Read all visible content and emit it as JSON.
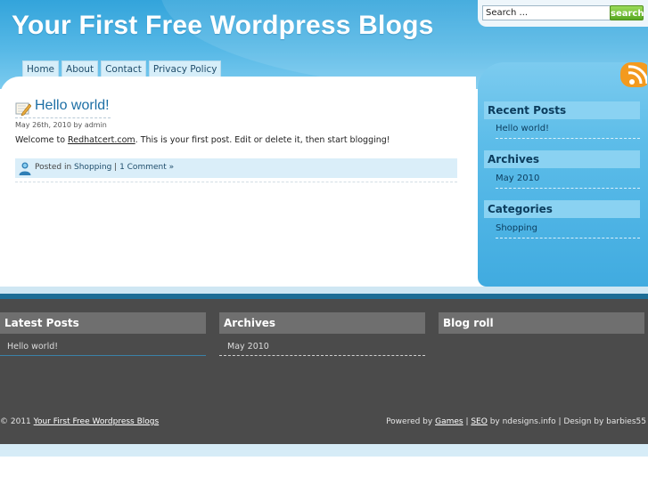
{
  "header": {
    "site_title": "Your First Free Wordpress Blogs",
    "search_placeholder": "Search ...",
    "search_button": "search"
  },
  "nav": {
    "items": [
      "Home",
      "About",
      "Contact",
      "Privacy Policy"
    ]
  },
  "post": {
    "title": "Hello world!",
    "meta": "May 26th, 2010 by admin",
    "body_prefix": "Welcome to ",
    "body_link": "Redhatcert.com",
    "body_suffix": ". This is your first post. Edit or delete it, then start blogging!",
    "posted_in_label": "Posted in ",
    "category": "Shopping",
    "separator": " | ",
    "comments": "1 Comment »"
  },
  "sidebar": {
    "recent_posts": {
      "heading": "Recent Posts",
      "items": [
        "Hello world!"
      ]
    },
    "archives": {
      "heading": "Archives",
      "items": [
        "May 2010"
      ]
    },
    "categories": {
      "heading": "Categories",
      "items": [
        "Shopping"
      ]
    }
  },
  "footer": {
    "latest_posts": {
      "heading": "Latest Posts",
      "items": [
        "Hello world!"
      ]
    },
    "archives": {
      "heading": "Archives",
      "items": [
        "May 2010"
      ]
    },
    "blogroll": {
      "heading": "Blog roll"
    },
    "copyright_prefix": "© 2011 ",
    "copyright_link": "Your First Free Wordpress Blogs",
    "powered_by": "Powered by ",
    "games_link": "Games",
    "sep1": " | ",
    "seo_link": "SEO",
    "credits_suffix": " by ndesigns.info | Design by barbies55"
  },
  "colors": {
    "header_blue": "#33a4db",
    "sidebar_blue": "#40abe0",
    "link_blue": "#1d6fa5",
    "footer_gray": "#4b4b4b",
    "search_green": "#58a821",
    "rss_orange": "#f39a1e"
  },
  "icons": {
    "post_icon": "pencil-paper-icon",
    "user_icon": "user-icon",
    "rss_icon": "rss-icon"
  }
}
